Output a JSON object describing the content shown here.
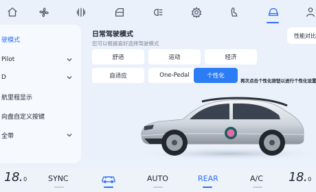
{
  "top_icons": [
    "fan-icon",
    "heated-seat-icon",
    "vehicle-door-icon",
    "headlight-icon",
    "settings-gear-icon",
    "seat-icon",
    "vehicle-drive-icon",
    "person-icon"
  ],
  "top_icon_active": "vehicle-drive-icon",
  "sidebar": {
    "items": [
      {
        "label": "驶模式",
        "active": true,
        "has_chevron": false
      },
      {
        "label": "Pilot",
        "active": false,
        "has_chevron": true
      },
      {
        "label": "D",
        "active": false,
        "has_chevron": true
      },
      {
        "label": "航里程显示",
        "active": false,
        "has_chevron": false
      },
      {
        "label": "向盘自定义按键",
        "active": false,
        "has_chevron": false
      },
      {
        "label": "全带",
        "active": false,
        "has_chevron": true
      }
    ]
  },
  "main": {
    "title": "日常驾驶模式",
    "hint": "您可以根据喜好选择驾驶模式",
    "compare_label": "性能对比",
    "modes": [
      {
        "label": "舒适",
        "selected": false
      },
      {
        "label": "运动",
        "selected": false
      },
      {
        "label": "经济",
        "selected": false
      },
      {
        "label": "自适应",
        "selected": false
      },
      {
        "label": "One-Pedal",
        "selected": false
      },
      {
        "label": "个性化",
        "selected": true
      }
    ],
    "selected_tip": "再次点击个性化按钮以进行个性化设置"
  },
  "bottom_bar": {
    "left_temp": "18.",
    "left_temp_unit": "0",
    "sync_label": "SYNC",
    "recirc_icon": "car-recirculation-icon",
    "auto_label": "AUTO",
    "rear_label": "REAR",
    "ac_label": "A/C",
    "right_temp": "18.",
    "right_temp_unit": "0"
  },
  "colors": {
    "accent": "#2c7cf6",
    "background": "#eaf1fb"
  }
}
